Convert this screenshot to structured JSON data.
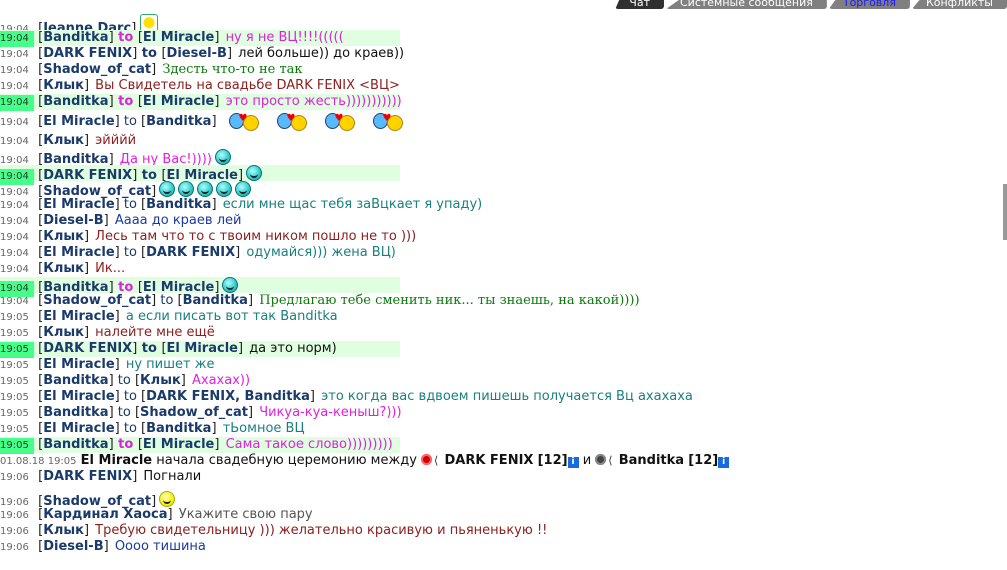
{
  "tabs": [
    {
      "label": "Чат",
      "state": "active"
    },
    {
      "label": "Системные сообщения",
      "state": "normal"
    },
    {
      "label": "Торговля",
      "state": "normal"
    },
    {
      "label": "Конфликты",
      "state": "normal"
    }
  ],
  "chat": {
    "lines": [
      {
        "time": "19:04",
        "nick": "Jeanne Darc",
        "to": "",
        "msg": "",
        "msg_color": "c-blue",
        "avatar": true
      },
      {
        "time": "19:04",
        "nick": "Banditka",
        "to": "El Miracle",
        "msg": "ну я не ВЦ!!!!(((((",
        "msg_color": "c-pink",
        "highlight": true,
        "to_style": "pink"
      },
      {
        "time": "19:04",
        "nick": "DARK FENIX",
        "to": "Diesel-B",
        "msg": "лей больше)) до краев))",
        "msg_color": "c-black",
        "to_style": "bold"
      },
      {
        "time": "19:04",
        "nick": "Shadow_of_cat",
        "to": "",
        "msg": "Здесть что-то не так",
        "msg_color": "c-green"
      },
      {
        "time": "19:04",
        "nick": "Клык",
        "to": "",
        "msg": "Вы Свидетель на свадьбе DARK FENIX <ВЦ>",
        "msg_color": "c-red"
      },
      {
        "time": "19:04",
        "nick": "Banditka",
        "to": "El Miracle",
        "msg": "это просто жесть)))))))))))",
        "msg_color": "c-pink",
        "highlight": true,
        "to_style": "pink"
      },
      {
        "time": "19:04",
        "nick": "El Miracle",
        "to": "Banditka",
        "msg": "",
        "msg_color": "c-teal",
        "kisses": 4,
        "big": true
      },
      {
        "time": "19:04",
        "nick": "Клык",
        "to": "",
        "msg": "эйййй",
        "msg_color": "c-red"
      },
      {
        "time": "19:04",
        "nick": "Banditka",
        "to": "",
        "msg": "Да ну Вас!))))",
        "msg_color": "c-pink",
        "smiles": [
          "teal"
        ]
      },
      {
        "time": "19:04",
        "nick": "DARK FENIX",
        "to": "El Miracle",
        "msg": "",
        "msg_color": "c-black",
        "highlight": true,
        "to_style": "bold",
        "smiles": [
          "teal"
        ]
      },
      {
        "time": "19:04",
        "nick": "Shadow_of_cat",
        "to": "",
        "msg": "",
        "msg_color": "c-green",
        "smiles": [
          "teal",
          "teal",
          "teal",
          "teal",
          "teal"
        ]
      },
      {
        "time": "19:04",
        "nick": "El Miracle",
        "to": "Banditka",
        "msg": "если мне щас тебя заВцкает я упаду)",
        "msg_color": "c-teal"
      },
      {
        "time": "19:04",
        "nick": "Diesel-B",
        "to": "",
        "msg": "Аааа до краев лей",
        "msg_color": "c-blue"
      },
      {
        "time": "19:04",
        "nick": "Клык",
        "to": "",
        "msg": "Лесь там что то с твоим ником пошло не то )))",
        "msg_color": "c-red"
      },
      {
        "time": "19:04",
        "nick": "El Miracle",
        "to": "DARK FENIX",
        "msg": "одумайся))) жена ВЦ)",
        "msg_color": "c-teal"
      },
      {
        "time": "19:04",
        "nick": "Клык",
        "to": "",
        "msg": "Ик...",
        "msg_color": "c-red"
      },
      {
        "time": "19:04",
        "nick": "Banditka",
        "to": "El Miracle",
        "msg": "",
        "msg_color": "c-pink",
        "highlight": true,
        "to_style": "pink",
        "smiles": [
          "teal"
        ]
      },
      {
        "time": "19:04",
        "nick": "Shadow_of_cat",
        "to": "Banditka",
        "msg": "Предлагаю тебе сменить ник... ты знаешь, на какой))))",
        "msg_color": "c-green"
      },
      {
        "time": "19:05",
        "nick": "El Miracle",
        "to": "",
        "msg": "а если писать вот так Banditka",
        "msg_color": "c-teal"
      },
      {
        "time": "19:05",
        "nick": "Клык",
        "to": "",
        "msg": "налейте мне ещё",
        "msg_color": "c-red"
      },
      {
        "time": "19:05",
        "nick": "DARK FENIX",
        "to": "El Miracle",
        "msg": "да это норм)",
        "msg_color": "c-black",
        "highlight": true,
        "to_style": "bold"
      },
      {
        "time": "19:05",
        "nick": "El Miracle",
        "to": "",
        "msg": "ну пишет же",
        "msg_color": "c-teal"
      },
      {
        "time": "19:05",
        "nick": "Banditka",
        "to": "Клык",
        "msg": "Ахахах))",
        "msg_color": "c-pink"
      },
      {
        "time": "19:05",
        "nick": "El Miracle",
        "to": "DARK FENIX, Banditka",
        "msg": "это когда вас вдвоем пишешь получается Вц ахахаха",
        "msg_color": "c-teal"
      },
      {
        "time": "19:05",
        "nick": "Banditka",
        "to": "Shadow_of_cat",
        "msg": "Чикуа-куа-кеныш?)))",
        "msg_color": "c-pink"
      },
      {
        "time": "19:05",
        "nick": "El Miracle",
        "to": "Banditka",
        "msg": "тЬомное ВЦ",
        "msg_color": "c-teal"
      },
      {
        "time": "19:05",
        "nick": "Banditka",
        "to": "El Miracle",
        "msg": "Сама такое слово)))))))))",
        "msg_color": "c-pink",
        "highlight": true,
        "to_style": "pink"
      }
    ],
    "system": {
      "time": "01.08.18 19:05",
      "actor": "El Miracle",
      "text": "начала свадебную церемонию между",
      "p1": "DARK FENIX",
      "p1_level": "[12]",
      "and": "и",
      "p2": "Banditka",
      "p2_level": "[12]"
    },
    "after": [
      {
        "time": "19:06",
        "nick": "DARK FENIX",
        "to": "",
        "msg": "Погнали",
        "msg_color": "c-black"
      },
      {
        "time": "19:06",
        "nick": "Shadow_of_cat",
        "to": "",
        "msg": "",
        "msg_color": "c-green",
        "smiles": [
          "yel"
        ],
        "gap": true
      },
      {
        "time": "19:06",
        "nick": "Кардинал Хаоса",
        "to": "",
        "msg": "Укажите свою пару",
        "msg_color": "c-grey"
      },
      {
        "time": "19:06",
        "nick": "Клык",
        "to": "",
        "msg": "Требую свидетельницу ))) желательно красивую и пьяненькую !!",
        "msg_color": "c-red"
      },
      {
        "time": "19:06",
        "nick": "Diesel-B",
        "to": "",
        "msg": "Оооо тишина",
        "msg_color": "c-blue"
      }
    ]
  }
}
